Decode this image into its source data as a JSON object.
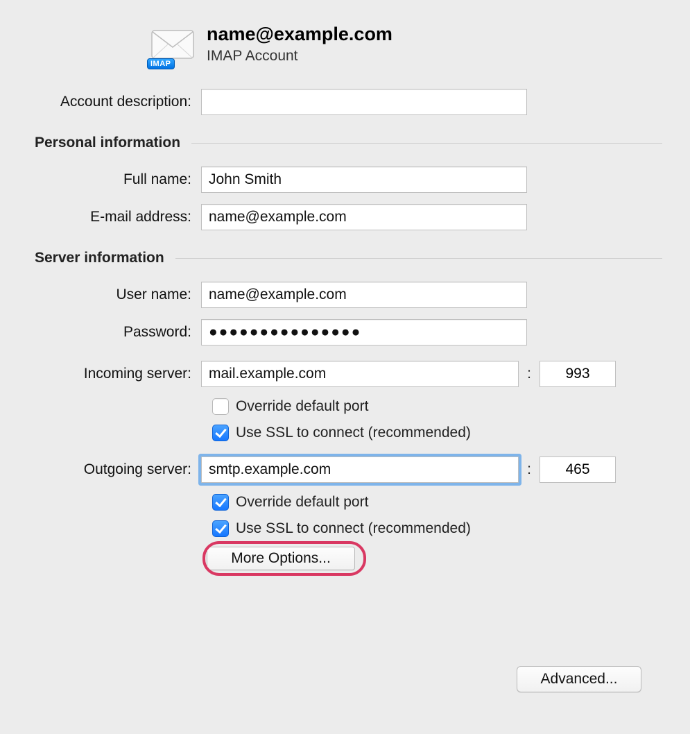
{
  "header": {
    "title": "name@example.com",
    "subtitle": "IMAP Account",
    "imap_badge": "IMAP"
  },
  "labels": {
    "account_description": "Account description:",
    "personal_info_section": "Personal information",
    "full_name": "Full name:",
    "email_address": "E-mail address:",
    "server_info_section": "Server information",
    "user_name": "User name:",
    "password": "Password:",
    "incoming_server": "Incoming server:",
    "outgoing_server": "Outgoing server:",
    "port_separator": ":",
    "override_port": "Override default port",
    "use_ssl": "Use SSL to connect (recommended)",
    "more_options": "More Options...",
    "advanced": "Advanced..."
  },
  "values": {
    "account_description": "",
    "full_name": "John Smith",
    "email_address": "name@example.com",
    "user_name": "name@example.com",
    "password": "●●●●●●●●●●●●●●●",
    "incoming_server": "mail.example.com",
    "incoming_port": "993",
    "outgoing_server": "smtp.example.com",
    "outgoing_port": "465"
  },
  "checks": {
    "incoming_override": false,
    "incoming_ssl": true,
    "outgoing_override": true,
    "outgoing_ssl": true
  },
  "highlight": {
    "more_options_ring_color": "#d93862",
    "outgoing_focus_color": "#7eb4ea"
  }
}
